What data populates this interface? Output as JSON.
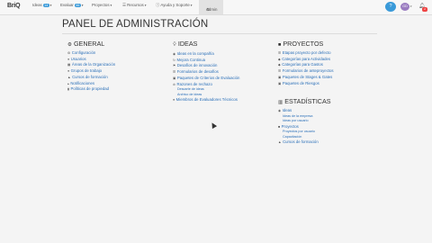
{
  "topbar": {
    "logo": "BriQ",
    "nav": [
      {
        "label": "Ideas",
        "badge": "14"
      },
      {
        "label": "Evaluar",
        "badge": "46"
      },
      {
        "label": "Proyectos",
        "badge": ""
      },
      {
        "label": "Recursos",
        "badge": ""
      },
      {
        "label": "Ayuda y Soporte",
        "badge": ""
      }
    ],
    "admin_label": "Admin",
    "help_glyph": "?",
    "avatar_initials": "GD",
    "notification_count": "2"
  },
  "page_title": "PANEL DE ADMINISTRACIÓN",
  "sections": {
    "general": {
      "title": "GENERAL",
      "items": [
        "Configuración",
        "Usuarios",
        "Áreas de la Organización",
        "Grupos de trabajo",
        "Cursos de formación",
        "Notificaciones",
        "Políticas de propiedad"
      ]
    },
    "ideas": {
      "title": "IDEAS",
      "items": [
        "Ideas en la compañía",
        "Mejora Continua",
        "Desafíos de innovación",
        "Formularios de desafíos",
        "Paquetes de Criterios de Evaluación",
        "Razones de rechazo"
      ],
      "subitems": [
        "Descarte de ideas",
        "Archivo de ideas"
      ],
      "last_item": "Miembros de Evaluadores Técnicos"
    },
    "proyectos": {
      "title": "PROYECTOS",
      "items": [
        "Etapas proyecto por defecto",
        "Categorías para Actividades",
        "Categorías para Gastos",
        "Formularios de anteproyectos",
        "Paquetes de Stages & Gates",
        "Paquetes de Riesgos"
      ]
    },
    "estadisticas": {
      "title": "ESTADÍSTICAS",
      "ideas_label": "Ideas",
      "ideas_sub": [
        "Ideas de la empresa",
        "Ideas por usuario"
      ],
      "proyectos_label": "Proyectos",
      "proyectos_sub": [
        "Proyectos por usuario",
        "Capacitación"
      ],
      "cursos_label": "Cursos de formación"
    }
  }
}
